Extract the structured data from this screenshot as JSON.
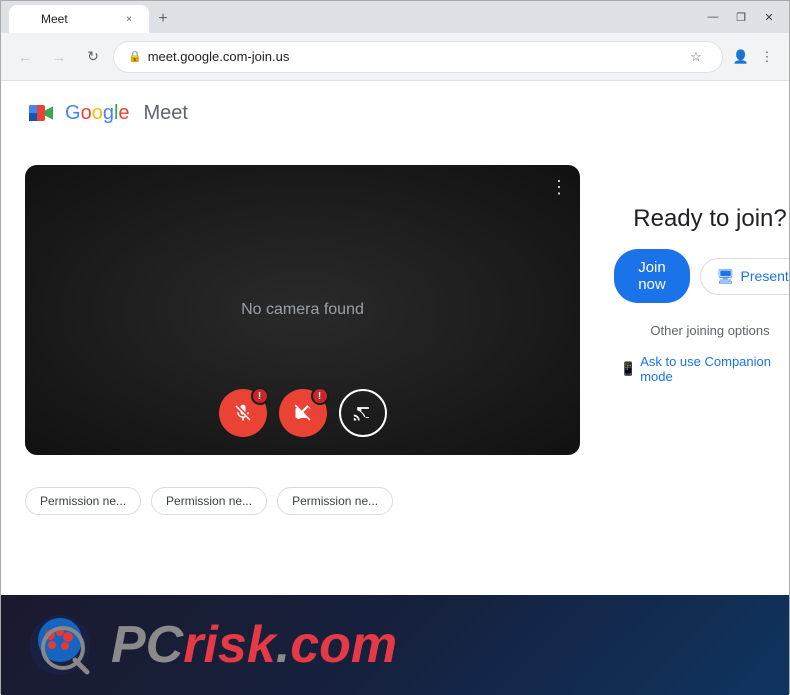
{
  "browser": {
    "tab": {
      "title": "Meet",
      "favicon": "meet-favicon",
      "close_label": "×"
    },
    "new_tab_label": "+",
    "controls": {
      "minimize": "—",
      "maximize": "❐",
      "close": "✕"
    },
    "nav": {
      "back": "←",
      "forward": "→",
      "reload": "↻"
    },
    "address": "meet.google.com-join.us",
    "address_icons": {
      "bookmark": "☆",
      "profile": "👤",
      "menu": "⋮"
    }
  },
  "meet": {
    "logo_google": "Google",
    "logo_meet": "Meet",
    "video_placeholder": "No camera found",
    "more_icon": "⋮",
    "controls": {
      "mic_label": "Mute microphone",
      "camera_label": "Turn off camera",
      "cast_label": "Cast",
      "badge_value": "!"
    },
    "permissions": [
      {
        "label": "Permission ne..."
      },
      {
        "label": "Permission ne..."
      },
      {
        "label": "Permission ne..."
      }
    ],
    "right_panel": {
      "ready_text": "Ready to join?",
      "join_now": "Join now",
      "present": "Present",
      "present_icon": "🖥",
      "other_options": "Other joining options",
      "companion_icon": "📱",
      "companion_text": "Ask to use Companion mode"
    }
  },
  "footer": {
    "brand_pc": "PC",
    "brand_risk": "risk",
    "brand_dot": ".",
    "brand_com": "com"
  }
}
